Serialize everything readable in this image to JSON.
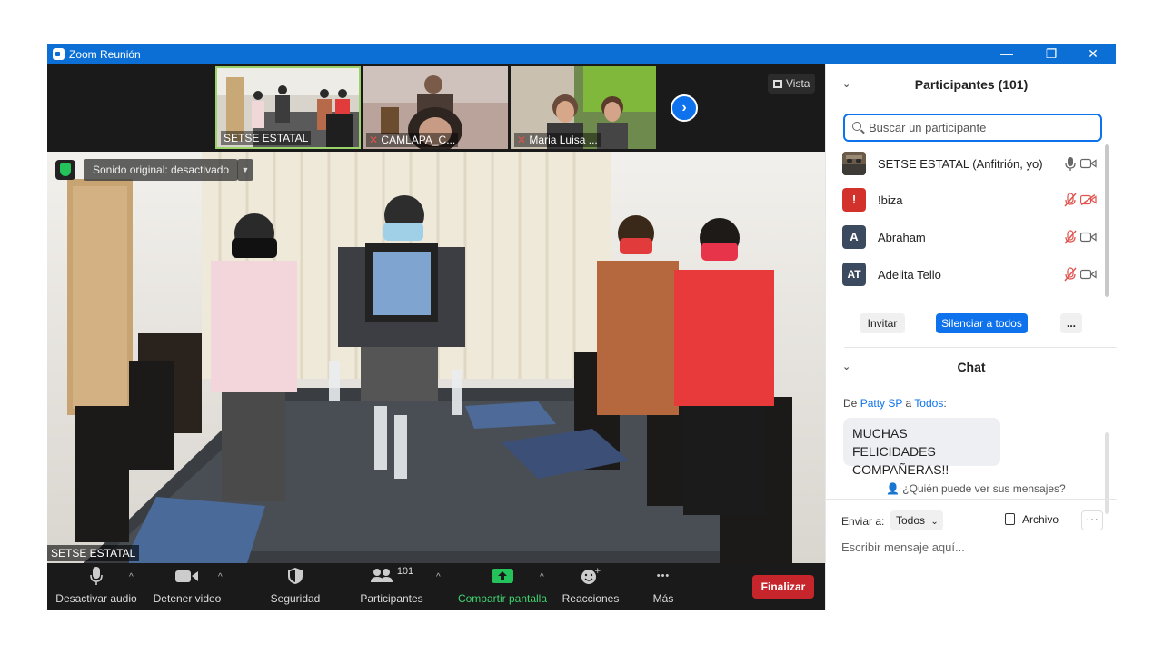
{
  "window": {
    "title": "Zoom Reunión",
    "controls": {
      "minimize": "—",
      "restore": "❐",
      "close": "✕"
    }
  },
  "gallery": {
    "thumbnails": [
      {
        "name": "SETSE ESTATAL",
        "muted": false
      },
      {
        "name": "CAMLAPA_C...",
        "muted": true
      },
      {
        "name": "Maria Luisa ...",
        "muted": true
      }
    ],
    "next_icon": "›",
    "view_label": "Vista"
  },
  "main_video": {
    "sound_label": "Sonido original: desactivado",
    "sound_arrow": "▼",
    "speaker_name": "SETSE ESTATAL"
  },
  "toolbar": {
    "audio_label": "Desactivar audio",
    "video_label": "Detener video",
    "security_label": "Seguridad",
    "participants_label": "Participantes",
    "participants_count": "101",
    "share_label": "Compartir pantalla",
    "reactions_label": "Reacciones",
    "more_label": "Más",
    "more_dots": "•••",
    "caret": "^",
    "end_label": "Finalizar"
  },
  "participants_panel": {
    "title": "Participantes (101)",
    "collapse_icon": "⌄",
    "search_placeholder": "Buscar un participante",
    "participants": [
      {
        "initials": "",
        "name": "SETSE ESTATAL (Anfitrión, yo)",
        "avatar_color": "#7a6a55",
        "mic_muted": false,
        "cam_off": false
      },
      {
        "initials": "!",
        "name": "!biza",
        "avatar_color": "#d3322c",
        "mic_muted": true,
        "cam_off": true
      },
      {
        "initials": "A",
        "name": "Abraham",
        "avatar_color": "#3b4a5e",
        "mic_muted": true,
        "cam_off": false
      },
      {
        "initials": "AT",
        "name": "Adelita Tello",
        "avatar_color": "#3b4a5e",
        "mic_muted": true,
        "cam_off": false
      }
    ],
    "invite_label": "Invitar",
    "mute_all_label": "Silenciar a todos",
    "more_label": "..."
  },
  "chat_panel": {
    "title": "Chat",
    "collapse_icon": "⌄",
    "messages": [
      {
        "prefix": "De ",
        "sender": "Patty SP",
        "connector": " a ",
        "recipient": "Todos",
        "suffix": ":",
        "text_line1": "MUCHAS FELICIDADES",
        "text_line2": "COMPAÑERAS!!"
      }
    ],
    "who_can_see": "¿Quién puede ver sus mensajes?",
    "send_to_label": "Enviar a:",
    "send_to_value": "Todos",
    "dropdown_icon": "⌄",
    "file_label": "Archivo",
    "more_label": "···",
    "input_placeholder": "Escribir mensaje aquí..."
  },
  "colors": {
    "accent": "#0e72ed",
    "end_button": "#c7252c",
    "muted_red": "#e0524c",
    "share_green": "#23c25a",
    "titlebar": "#0b6fd6"
  }
}
